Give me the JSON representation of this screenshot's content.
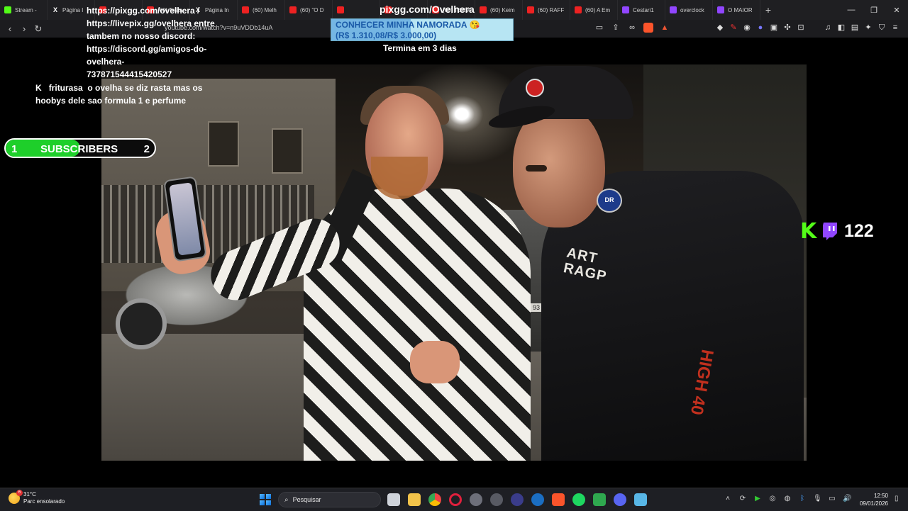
{
  "browser": {
    "tabs": [
      {
        "label": "Stream -",
        "favicon": "kick"
      },
      {
        "label": "Página I",
        "favicon": "x"
      },
      {
        "label": "",
        "favicon": "youtube"
      },
      {
        "label": "(60) Testa",
        "favicon": "youtube"
      },
      {
        "label": "Página In",
        "favicon": "x"
      },
      {
        "label": "(60) Melh",
        "favicon": "youtube"
      },
      {
        "label": "(60) \"O D",
        "favicon": "youtube"
      },
      {
        "label": "",
        "favicon": "youtube"
      },
      {
        "label": "",
        "favicon": "youtube"
      },
      {
        "label": "(60) TERM",
        "favicon": "youtube"
      },
      {
        "label": "(60) Keim",
        "favicon": "youtube"
      },
      {
        "label": "(60) RAFF",
        "favicon": "youtube"
      },
      {
        "label": "(60) A Em",
        "favicon": "youtube"
      },
      {
        "label": "Cestari1",
        "favicon": "twitch"
      },
      {
        "label": "overclock",
        "favicon": "twitch"
      },
      {
        "label": "O MAIOR",
        "favicon": "twitch"
      }
    ],
    "new_tab_glyph": "+",
    "url": "youtube.com/watch?v=n9uVDDb14uA"
  },
  "chat": {
    "pinned_lines": [
      "https://pixgg.com/ovelhera /",
      "https://livepix.gg/ovelhera entre",
      "tambem no nosso discord:",
      "https://discord.gg/amigos-do-",
      "ovelhera-",
      "737871544415420527"
    ],
    "message": {
      "username": "friturasa",
      "platform_icon": "kick",
      "lines": [
        "o ovelha se diz rasta mas os",
        "hoobys dele sao formula 1 e",
        "perfume"
      ]
    }
  },
  "donation": {
    "title": "pixgg.com/Ovelhera",
    "goal_label": "CONHECER MINHA NAMORADA 😘",
    "goal_amount": "(R$ 1.310,08/R$ 3.000,00)",
    "goal_progress": 0.437,
    "goal_color": "#b7e5f3",
    "ends_text": "Termina em 3 dias"
  },
  "subscribers_bar": {
    "current": "1",
    "label": "SUBSCRIBERS",
    "goal": "2",
    "progress": 0.5,
    "fill_color": "#1ecf2a"
  },
  "viewers": {
    "platforms": [
      "kick",
      "twitch"
    ],
    "count": "122"
  },
  "video_scene": {
    "plate_text": "93",
    "patch_text": "DR",
    "jacket_text": "ART RAGP",
    "sleeve_text": "HIGH 40"
  },
  "taskbar": {
    "weather": {
      "temperature": "31°C",
      "condition": "Parc ensolarado",
      "badge": "6"
    },
    "search_placeholder": "Pesquisar",
    "apps": [
      "file-explorer",
      "files",
      "chrome",
      "opera-gx",
      "app",
      "steam-alt",
      "arrow-app",
      "steam",
      "brave",
      "spotify",
      "media",
      "discord",
      "notepad"
    ],
    "time": "12:50",
    "date": "09/01/2026"
  }
}
